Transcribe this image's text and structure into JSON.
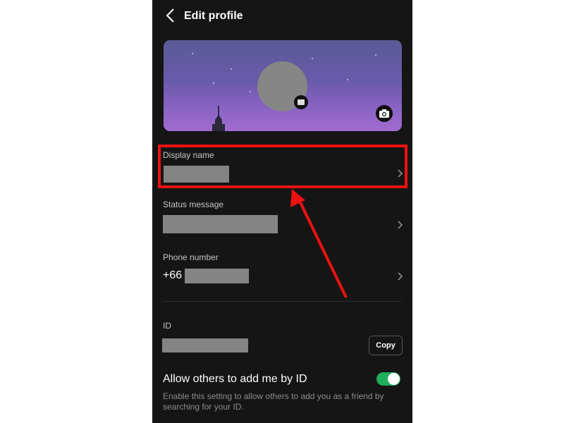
{
  "header": {
    "title": "Edit profile",
    "back_icon": "chevron-left-icon"
  },
  "cover": {
    "camera_icon": "camera-icon",
    "avatar_badge_icon": "edit-icon"
  },
  "fields": {
    "display_name": {
      "label": "Display name"
    },
    "status_message": {
      "label": "Status message"
    },
    "phone_number": {
      "label": "Phone number",
      "prefix": "+66"
    },
    "id": {
      "label": "ID",
      "copy_label": "Copy"
    }
  },
  "allow_id": {
    "title": "Allow others to add me by ID",
    "description": "Enable this setting to allow others to add you as a friend by searching for your ID.",
    "enabled": true
  },
  "colors": {
    "background": "#151515",
    "toggle_on": "#1fae5c",
    "annotation": "#ee1111",
    "redaction": "#848484"
  }
}
